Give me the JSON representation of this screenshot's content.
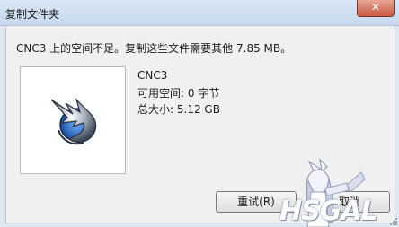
{
  "window": {
    "title": "复制文件夹",
    "close_symbol": "✕"
  },
  "message": "CNC3 上的空间不足。复制这些文件需要其他 7.85 MB。",
  "drive": {
    "icon": "cnc3-app-icon",
    "name": "CNC3",
    "free_label": "可用空间:",
    "free_value": "0 字节",
    "total_label": "总大小:",
    "total_value": "5.12 GB"
  },
  "buttons": {
    "retry": "重试(R)",
    "cancel": "取消"
  },
  "watermark": {
    "text": "HSGAL"
  },
  "colors": {
    "title_bar": "#c7d8ee",
    "close_button": "#c85a45",
    "dialog_body": "#f0f0f0"
  }
}
